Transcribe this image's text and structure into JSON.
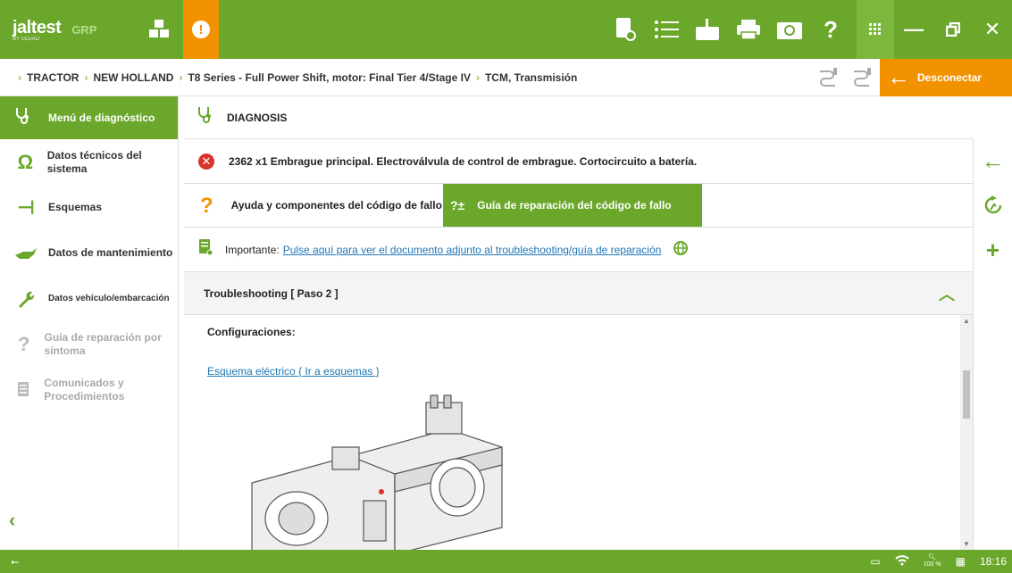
{
  "app": {
    "brand": "jaltest",
    "brand_sub": "BY COJALI",
    "brand_tag": "GRP"
  },
  "breadcrumb": [
    "TRACTOR",
    "NEW HOLLAND",
    "T8 Series - Full Power Shift, motor: Final Tier 4/Stage IV",
    "TCM, Transmisión"
  ],
  "disconnect_label": "Desconectar",
  "sidebar": {
    "header": "Menú de diagnóstico",
    "items": [
      {
        "label": "Datos técnicos del sistema",
        "icon": "ohm-icon"
      },
      {
        "label": "Esquemas",
        "icon": "schematic-icon"
      },
      {
        "label": "Datos de mantenimiento",
        "icon": "oilcan-icon"
      },
      {
        "label": "Datos vehículo/embarcación",
        "icon": "wrench-icon"
      },
      {
        "label": "Guía de reparación por síntoma",
        "icon": "repair-guide-icon"
      },
      {
        "label": "Comunicados y Procedimientos",
        "icon": "documents-icon"
      }
    ]
  },
  "diagnosis": {
    "title": "DIAGNOSIS",
    "fault_code": "2362 x1  Embrague principal. Electroválvula de control de embrague. Cortocircuito a batería.",
    "tab_help": "Ayuda y componentes del código de fallo",
    "tab_repair": "Guía de reparación del código de fallo",
    "important_label": "Importante:",
    "important_link": "Pulse aquí para ver el documento adjunto al troubleshooting/guía de reparación",
    "troubleshooting_title": "Troubleshooting [ Paso 2 ]",
    "config_label": "Configuraciones:",
    "schematic_link": "Esquema eléctrico { Ir a esquemas }"
  },
  "status": {
    "zoom": "100 %",
    "time": "18:16"
  },
  "colors": {
    "brand_green": "#6aa72b",
    "accent_orange": "#f39200",
    "error_red": "#d9342b",
    "link_blue": "#1f77b4"
  }
}
